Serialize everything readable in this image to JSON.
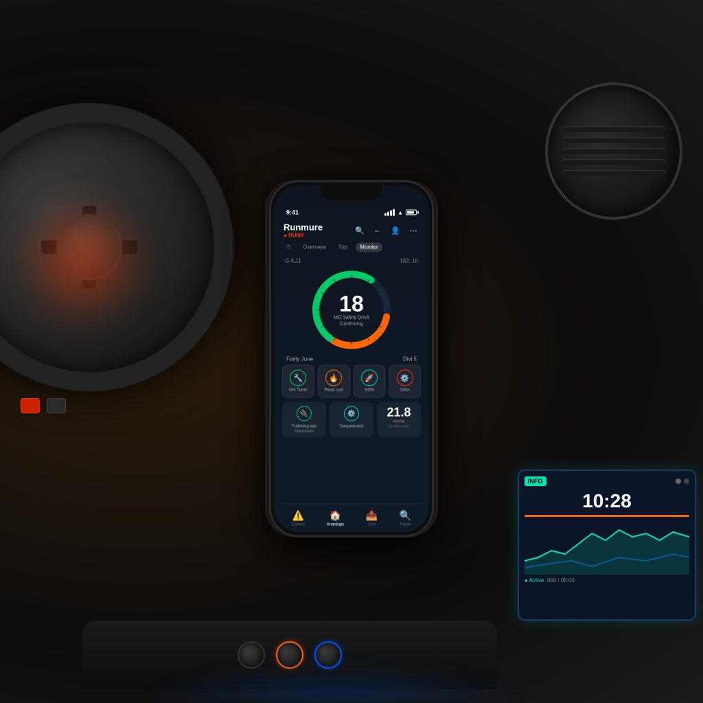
{
  "scene": {
    "background_color": "#0d0d0d",
    "description": "Smartphone mounted in car dashboard showing vehicle monitoring app"
  },
  "phone": {
    "status_bar": {
      "time": "9:41",
      "signal": "full",
      "battery": "70"
    },
    "app": {
      "title": "Runmure",
      "subtitle": "RUNV",
      "tabs": [
        "Overview",
        "Trip",
        "Monitor"
      ],
      "active_tab": "Overview",
      "header_icons": [
        "search",
        "back",
        "user",
        "menu"
      ],
      "gauge": {
        "speed_label": "G-5.11",
        "speed_range": "162:.10",
        "speed_value": "18",
        "speed_sub_line1": "MG Safety DrivA",
        "speed_sub_line2": "Continuing",
        "arc_orange_percent": 30,
        "arc_green_percent": 65
      },
      "stats": {
        "left_label": "Fairly June",
        "right_label": "Divi 5",
        "left_value": "",
        "right_value": ""
      },
      "feature_cards": [
        {
          "icon": "🔧",
          "label": "N% Tuner",
          "color": "green"
        },
        {
          "icon": "🔥",
          "label": "Perac cod",
          "color": "orange"
        },
        {
          "icon": "🚀",
          "label": "NON",
          "color": "teal"
        },
        {
          "icon": "🔴",
          "label": "Vritor",
          "color": "red"
        }
      ],
      "second_row_cards": [
        {
          "icon": "🔌",
          "label": "Trainning adv",
          "sub": "Torquesmont"
        },
        {
          "icon": "⚙️",
          "label": "Torquesmont",
          "sub": ""
        },
        {
          "big_number": "21.8",
          "label": "Advise",
          "sub": "Carriformatter"
        }
      ],
      "bottom_nav": [
        {
          "icon": "⚠️",
          "label": "Control",
          "active": false
        },
        {
          "icon": "🏠",
          "label": "Anardops",
          "active": true
        },
        {
          "icon": "📤",
          "label": "Chrt",
          "active": false
        },
        {
          "icon": "🔍",
          "label": "Plane",
          "active": false
        }
      ]
    }
  },
  "infotainment": {
    "badge": "INFO",
    "time": "10:28",
    "sub_text": "Active",
    "stats": [
      "000",
      "00:00"
    ]
  }
}
